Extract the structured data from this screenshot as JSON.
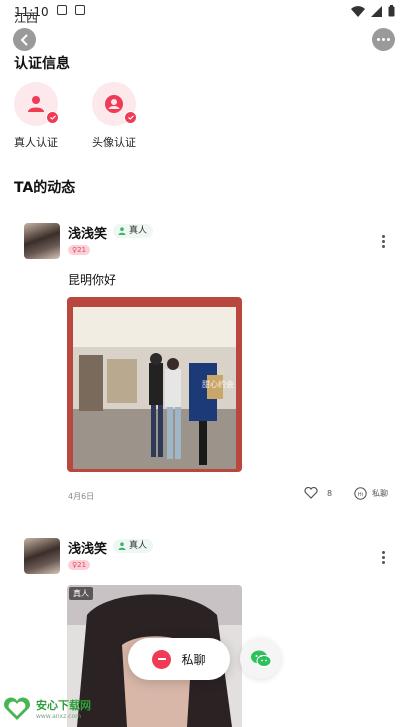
{
  "status_bar": {
    "time": "11:10",
    "location": "江西"
  },
  "certification": {
    "title": "认证信息",
    "items": [
      {
        "label": "真人认证",
        "icon": "person-icon"
      },
      {
        "label": "头像认证",
        "icon": "avatar-badge-icon"
      }
    ]
  },
  "feed": {
    "title": "TA的动态",
    "posts": [
      {
        "username": "浅浅笑",
        "real_tag": "真人",
        "age_tag": "21",
        "text": "昆明你好",
        "photo_watermark": "甜心约会",
        "date": "4月6日",
        "likes": "8",
        "chat_label": "私聊"
      },
      {
        "username": "浅浅笑",
        "real_tag": "真人",
        "age_tag": "21",
        "photo_overlay_tag": "真人"
      }
    ]
  },
  "floating": {
    "chat_label": "私聊"
  },
  "watermark": {
    "name": "安心下载网",
    "url": "www.anxz.com"
  },
  "colors": {
    "accent": "#ef3b55",
    "badge_bg": "#fde8ec",
    "real_tag_bg": "#eef7f2"
  }
}
